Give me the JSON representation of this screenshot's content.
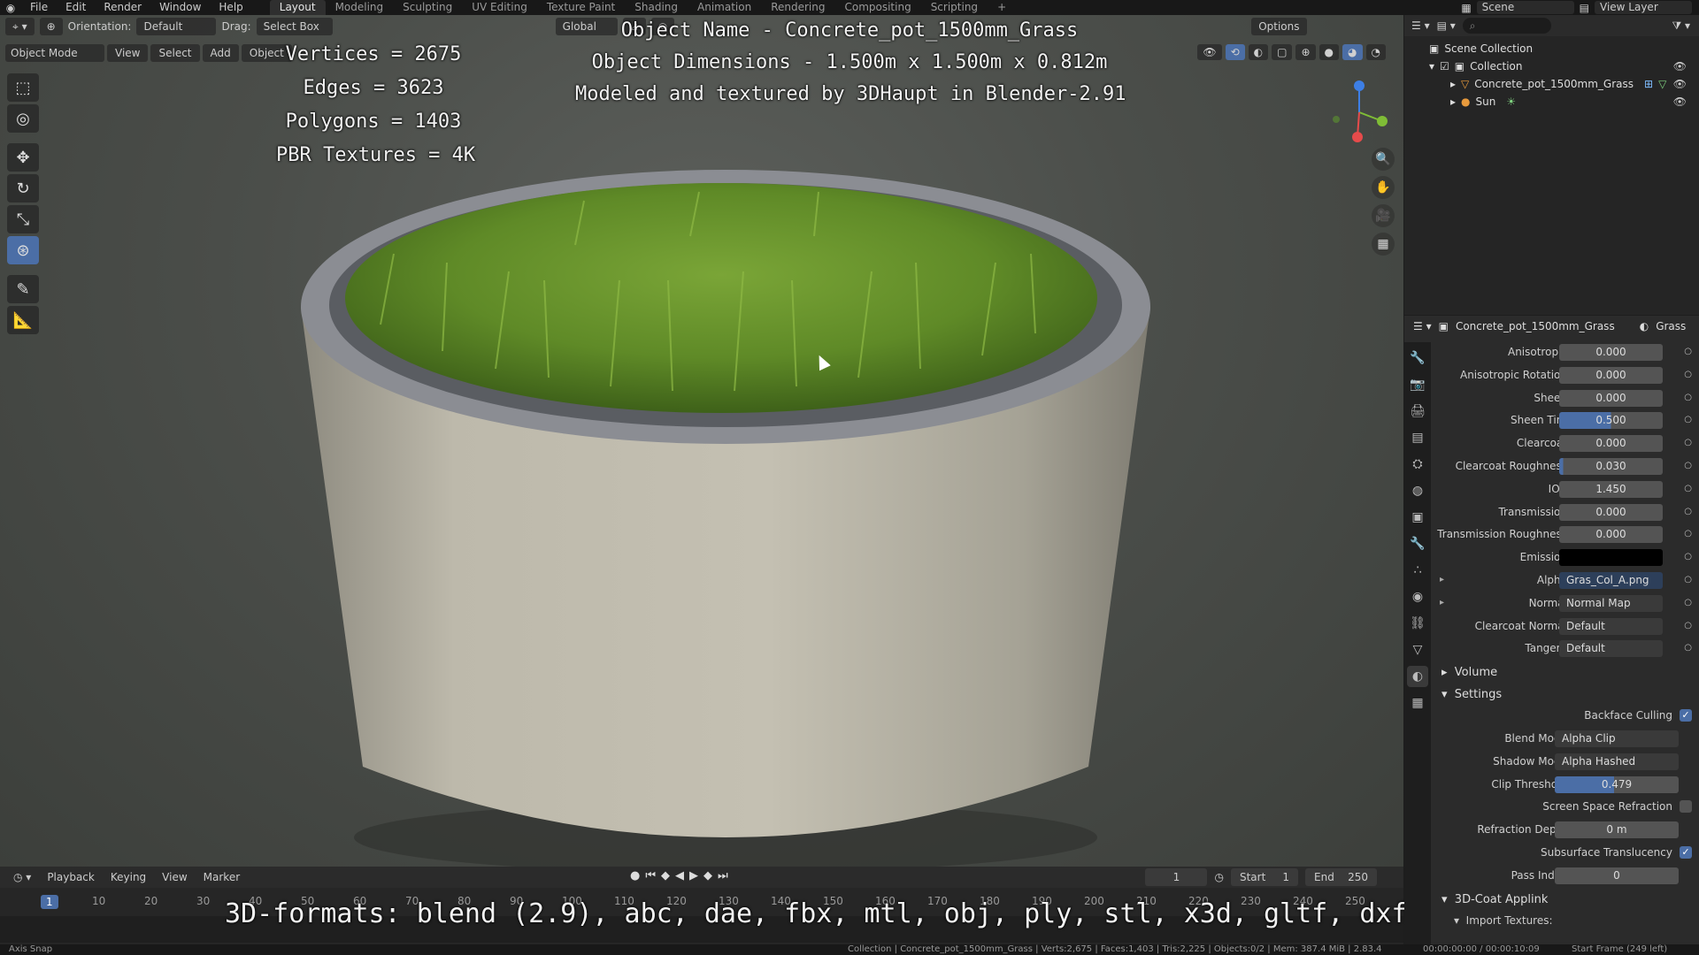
{
  "topbar": {
    "menu": [
      "File",
      "Edit",
      "Render",
      "Window",
      "Help"
    ],
    "workspaces": [
      "Layout",
      "Modeling",
      "Sculpting",
      "UV Editing",
      "Texture Paint",
      "Shading",
      "Animation",
      "Rendering",
      "Compositing",
      "Scripting"
    ],
    "active_workspace": "Layout",
    "scene": "Scene",
    "view_layer": "View Layer"
  },
  "viewport": {
    "orientation_label": "Orientation:",
    "orientation_value": "Default",
    "drag_label": "Drag:",
    "drag_value": "Select Box",
    "transform_orientation": "Global",
    "options": "Options",
    "mode": "Object Mode",
    "menus": [
      "View",
      "Select",
      "Add",
      "Object"
    ]
  },
  "overlay": {
    "stats": [
      "Vertices = 2675",
      "Edges = 3623",
      "Polygons = 1403",
      "PBR Textures = 4K"
    ],
    "info": [
      "Object Name - Concrete_pot_1500mm_Grass",
      "Object Dimensions -  1.500m x 1.500m x 0.812m",
      "Modeled and textured by 3DHaupt in Blender-2.91"
    ],
    "formats": "3D-formats: blend (2.9), abc, dae, fbx, mtl, obj, ply, stl, x3d, gltf, dxf"
  },
  "timeline": {
    "menus": [
      "Playback",
      "Keying",
      "View",
      "Marker"
    ],
    "current_frame": "1",
    "start_label": "Start",
    "start": "1",
    "end_label": "End",
    "end": "250",
    "ruler": [
      "10",
      "20",
      "30",
      "40",
      "50",
      "60",
      "70",
      "80",
      "90",
      "100",
      "110",
      "120",
      "130",
      "140",
      "150",
      "160",
      "170",
      "180",
      "190",
      "200",
      "210",
      "220",
      "230",
      "240",
      "250"
    ],
    "playhead": "1"
  },
  "statusbar": {
    "left": "Axis Snap",
    "center": "Collection | Concrete_pot_1500mm_Grass | Verts:2,675 | Faces:1,403 | Tris:2,225 | Objects:0/2 | Mem: 387.4 MiB | 2.83.4",
    "right_time": "00:00:00:00 / 00:00:10:09",
    "right_frame": "Start Frame (249 left)"
  },
  "outliner": {
    "root": "Scene Collection",
    "collection": "Collection",
    "objects": [
      "Concrete_pot_1500mm_Grass",
      "Sun"
    ]
  },
  "properties": {
    "object": "Concrete_pot_1500mm_Grass",
    "material": "Grass",
    "rows": [
      {
        "label": "Anisotropic",
        "value": "0.000",
        "style": "num"
      },
      {
        "label": "Anisotropic Rotation",
        "value": "0.000",
        "style": "num"
      },
      {
        "label": "Sheen",
        "value": "0.000",
        "style": "num"
      },
      {
        "label": "Sheen Tint",
        "value": "0.500",
        "style": "half"
      },
      {
        "label": "Clearcoat",
        "value": "0.000",
        "style": "num"
      },
      {
        "label": "Clearcoat Roughness",
        "value": "0.030",
        "style": "part"
      },
      {
        "label": "IOR",
        "value": "1.450",
        "style": "num"
      },
      {
        "label": "Transmission",
        "value": "0.000",
        "style": "num"
      },
      {
        "label": "Transmission Roughness",
        "value": "0.000",
        "style": "num"
      },
      {
        "label": "Emission",
        "value": "",
        "style": "emis"
      },
      {
        "label": "Alpha",
        "value": "Gras_Col_A.png",
        "style": "tex"
      },
      {
        "label": "Normal",
        "value": "Normal Map",
        "style": "dd"
      },
      {
        "label": "Clearcoat Normal",
        "value": "Default",
        "style": "dd"
      },
      {
        "label": "Tangent",
        "value": "Default",
        "style": "dd"
      }
    ],
    "volume": "Volume",
    "settings": "Settings",
    "settings_rows": [
      {
        "label": "Backface Culling",
        "type": "check",
        "on": true
      },
      {
        "label": "Blend Mode",
        "type": "dd",
        "value": "Alpha Clip"
      },
      {
        "label": "Shadow Mode",
        "type": "dd",
        "value": "Alpha Hashed"
      },
      {
        "label": "Clip Threshold",
        "type": "slider",
        "value": "0.479"
      },
      {
        "label": "Screen Space Refraction",
        "type": "check",
        "on": false
      },
      {
        "label": "Refraction Depth",
        "type": "num",
        "value": "0 m"
      },
      {
        "label": "Subsurface Translucency",
        "type": "check",
        "on": true
      },
      {
        "label": "Pass Index",
        "type": "num",
        "value": "0"
      }
    ],
    "addon": "3D-Coat Applink",
    "addon_sub": "Import Textures:"
  },
  "colors": {
    "accent": "#4b6ea6",
    "grass": "#6f9a2e",
    "concrete": "#b7b3a5"
  }
}
